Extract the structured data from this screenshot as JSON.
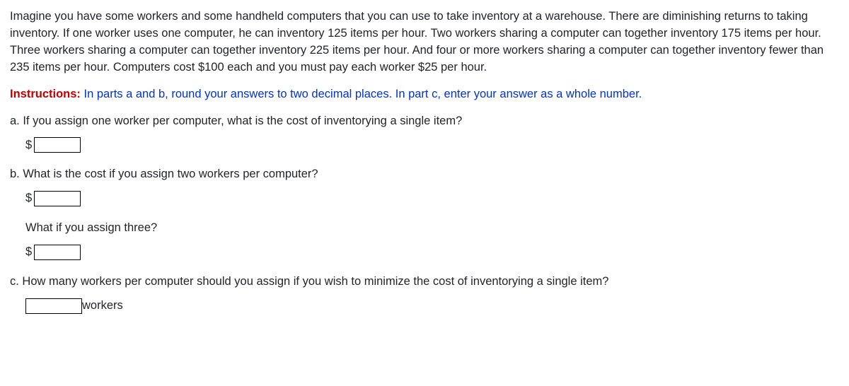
{
  "intro_paragraph": "Imagine you have some workers and some handheld computers that you can use to take inventory at a warehouse. There are diminishing returns to taking inventory. If one worker uses one computer, he can inventory 125 items per hour. Two workers sharing a computer can together inventory 175 items per hour. Three workers sharing a computer can together inventory 225 items per hour. And four or more workers sharing a computer can together inventory fewer than 235 items per hour. Computers cost $100 each and you must pay each worker $25 per hour.",
  "instructions_label": "Instructions:",
  "instructions_text": " In parts a and b, round your answers to two decimal places. In part c, enter your answer as a whole number.",
  "part_a": {
    "question": "a. If you assign one worker per computer, what is the cost of inventorying a single item?",
    "prefix": "$",
    "value": ""
  },
  "part_b": {
    "question": "b. What is the cost if you assign two workers per computer?",
    "prefix": "$",
    "value_two": "",
    "sub_question": "What if you assign three?",
    "prefix_three": "$",
    "value_three": ""
  },
  "part_c": {
    "question": "c. How many workers per computer should you assign if you wish to minimize the cost of inventorying a single item?",
    "value": "",
    "suffix": "workers"
  }
}
